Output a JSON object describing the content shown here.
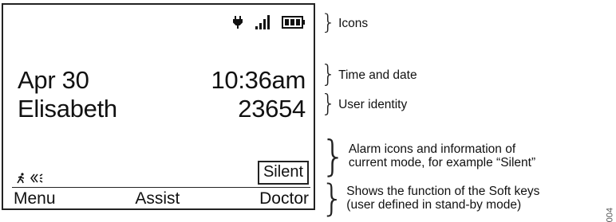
{
  "display": {
    "status_icons": [
      "charging-plug-icon",
      "signal-strength-icon",
      "battery-icon"
    ],
    "date": "Apr 30",
    "time": "10:36am",
    "user_name": "Elisabeth",
    "user_number": "23654",
    "alarm_icons": [
      "man-down-icon",
      "no-movement-icon"
    ],
    "mode": "Silent",
    "softkeys": [
      "Menu",
      "Assist",
      "Doctor"
    ]
  },
  "callouts": {
    "icons": "Icons",
    "time_date": "Time and date",
    "user_identity": "User identity",
    "alarm_line1": "Alarm icons and information of",
    "alarm_line2": "current mode, for example “Silent”",
    "soft_line1": "Shows the function of the Soft keys",
    "soft_line2": "(user defined in stand-by mode)"
  },
  "figure_number": "004"
}
